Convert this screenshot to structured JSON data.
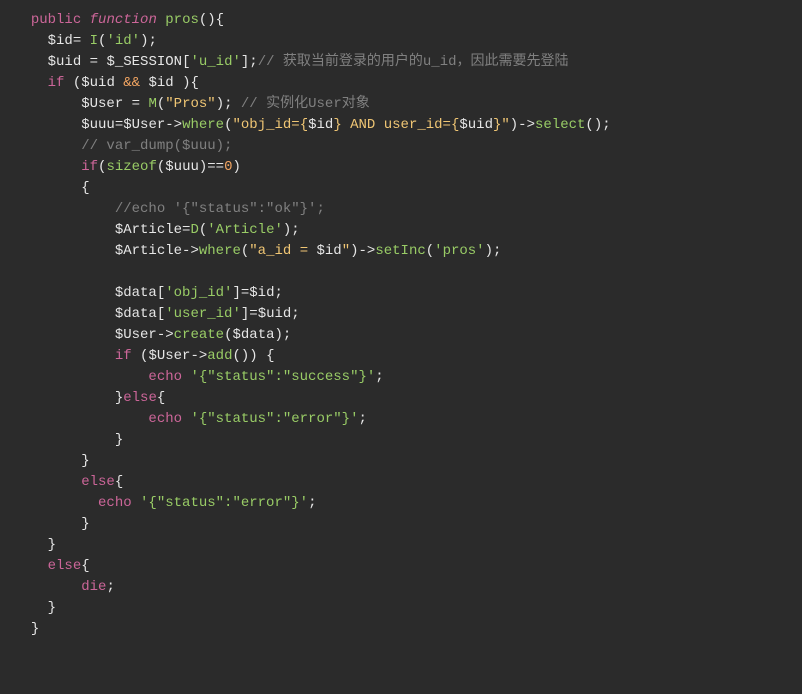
{
  "lines": {
    "l1": {
      "kw1": "public",
      "kw2": "function",
      "fn": "pros",
      "p": "(){"
    },
    "l2": {
      "var": "$id",
      "eq": "= ",
      "fn": "I",
      "p1": "(",
      "str": "'id'",
      "p2": ");"
    },
    "l3": {
      "var1": "$uid",
      "eq": " = ",
      "var2": "$_SESSION",
      "br1": "[",
      "str": "'u_id'",
      "br2": "];",
      "cmt": "// 获取当前登录的用户的u_id，因此需要先登陆"
    },
    "l4": {
      "kw": "if",
      "p1": " (",
      "var1": "$uid",
      "op": " && ",
      "var2": "$id",
      "p2": " ){"
    },
    "l5": {
      "var": "$User",
      "eq": " = ",
      "fn": "M",
      "p1": "(",
      "str": "\"Pros\"",
      "p2": "); ",
      "cmt": "// 实例化User对象"
    },
    "l6": {
      "var1": "$uuu",
      "eq": "=",
      "var2": "$User",
      "ar": "->",
      "fn1": "where",
      "p1": "(",
      "s1": "\"obj_id={",
      "v1": "$id",
      "s2": "} AND user_id={",
      "v2": "$uid",
      "s3": "}\"",
      "p2": ")->",
      "fn2": "select",
      "p3": "();"
    },
    "l7": {
      "cmt": "// var_dump($uuu);"
    },
    "l8": {
      "kw": "if",
      "p1": "(",
      "fn": "sizeof",
      "p2": "(",
      "var": "$uuu",
      "p3": ")",
      "eq": "==",
      "num": "0",
      "p4": ")"
    },
    "l9": {
      "p": "{"
    },
    "l10": {
      "cmt": "//echo '{\"status\":\"ok\"}';"
    },
    "l11": {
      "var": "$Article",
      "eq": "=",
      "fn": "D",
      "p1": "(",
      "str": "'Article'",
      "p2": ");"
    },
    "l12": {
      "var": "$Article",
      "ar": "->",
      "fn1": "where",
      "p1": "(",
      "s1": "\"a_id = ",
      "v1": "$id",
      "s2": "\"",
      "p2": ")->",
      "fn2": "setInc",
      "p3": "(",
      "str": "'pros'",
      "p4": ");"
    },
    "l13": {
      "var": "$data",
      "br1": "[",
      "str": "'obj_id'",
      "br2": "]=",
      "val": "$id",
      "p": ";"
    },
    "l14": {
      "var": "$data",
      "br1": "[",
      "str": "'user_id'",
      "br2": "]=",
      "val": "$uid",
      "p": ";"
    },
    "l15": {
      "var1": "$User",
      "ar": "->",
      "fn": "create",
      "p1": "(",
      "var2": "$data",
      "p2": ");"
    },
    "l16": {
      "kw": "if",
      "p1": " (",
      "var": "$User",
      "ar": "->",
      "fn": "add",
      "p2": "()) {"
    },
    "l17": {
      "kw": "echo",
      "sp": " ",
      "str": "'{\"status\":\"success\"}'",
      "p": ";"
    },
    "l18": {
      "p1": "}",
      "kw": "else",
      "p2": "{"
    },
    "l19": {
      "kw": "echo",
      "sp": " ",
      "str": "'{\"status\":\"error\"}'",
      "p": ";"
    },
    "l20": {
      "p": "}"
    },
    "l21": {
      "p": "}"
    },
    "l22": {
      "kw": "else",
      "p": "{"
    },
    "l23": {
      "kw": "echo",
      "sp": " ",
      "str": "'{\"status\":\"error\"}'",
      "p": ";"
    },
    "l24": {
      "p": "}"
    },
    "l25": {
      "p": "}"
    },
    "l26": {
      "kw": "else",
      "p": "{"
    },
    "l27": {
      "kw": "die",
      "p": ";"
    },
    "l28": {
      "p": "}"
    },
    "l29": {
      "p": "}"
    }
  }
}
